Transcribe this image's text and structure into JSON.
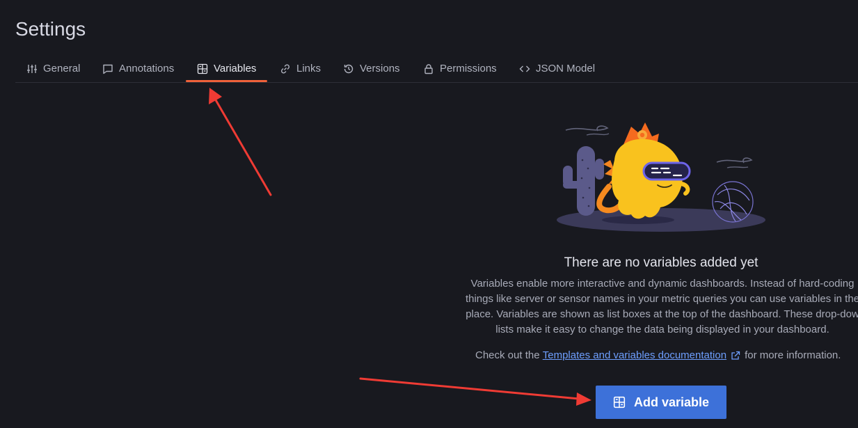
{
  "page": {
    "title": "Settings"
  },
  "tabs": [
    {
      "label": "General",
      "icon": "sliders-icon",
      "active": false
    },
    {
      "label": "Annotations",
      "icon": "comment-icon",
      "active": false
    },
    {
      "label": "Variables",
      "icon": "variable-icon",
      "active": true
    },
    {
      "label": "Links",
      "icon": "link-icon",
      "active": false
    },
    {
      "label": "Versions",
      "icon": "history-icon",
      "active": false
    },
    {
      "label": "Permissions",
      "icon": "lock-icon",
      "active": false
    },
    {
      "label": "JSON Model",
      "icon": "code-icon",
      "active": false
    }
  ],
  "empty_state": {
    "title": "There are no variables added yet",
    "description_lines": [
      "Variables enable more interactive and dynamic dashboards. Instead of hard-coding",
      "things like server or sensor names in your metric queries you can use variables in the",
      "place. Variables are shown as list boxes at the top of the dashboard. These drop-dow",
      "lists make it easy to change the data being displayed in your dashboard."
    ],
    "more_info_prefix": "Check out the",
    "more_info_link": "Templates and variables documentation",
    "more_info_suffix": "for more information."
  },
  "actions": {
    "add_variable_label": "Add variable"
  },
  "colors": {
    "background": "#18191f",
    "active_tab_underline": "#f0613a",
    "primary_button": "#3d71d9",
    "link": "#6e9fff",
    "annotation_arrow": "#ef3b34"
  }
}
